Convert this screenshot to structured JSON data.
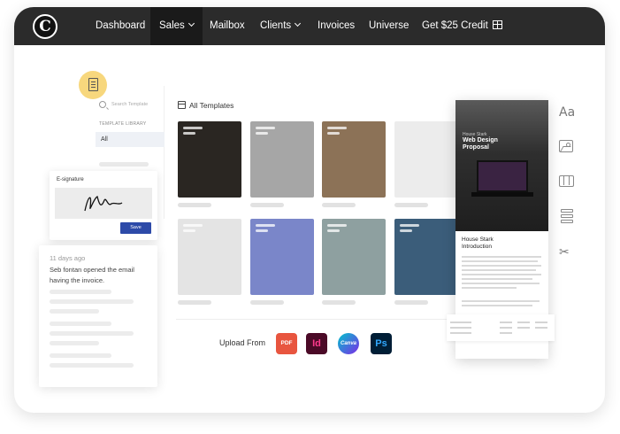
{
  "app": {
    "logo_letter": "C"
  },
  "nav": {
    "dashboard": "Dashboard",
    "sales": "Sales",
    "mailbox": "Mailbox",
    "clients": "Clients",
    "invoices": "Invoices",
    "universe": "Universe",
    "credit": "Get $25 Credit"
  },
  "sidebar": {
    "search_placeholder": "Search Template",
    "library_label": "TEMPLATE LIBRARY",
    "active_item": "All"
  },
  "esignature": {
    "title": "E-signature",
    "save_label": "Save"
  },
  "activity": {
    "time": "11 days ago",
    "message": "Seb fontan opened the email having the invoice."
  },
  "templates": {
    "header": "All Templates",
    "items": [
      {
        "name": "desk-setup",
        "color": "#2a2622"
      },
      {
        "name": "camera",
        "color": "#a6a6a6"
      },
      {
        "name": "team-meeting",
        "color": "#8c7257"
      },
      {
        "name": "blank",
        "color": "#ececec"
      },
      {
        "name": "plant",
        "color": "#e4e4e4"
      },
      {
        "name": "abstract-3d",
        "color": "#7a86c9"
      },
      {
        "name": "workspace-top",
        "color": "#8ea0a0"
      },
      {
        "name": "building",
        "color": "#3b5d7a"
      }
    ]
  },
  "upload": {
    "label": "Upload From",
    "apps": [
      {
        "name": "pdf",
        "text": "PDF"
      },
      {
        "name": "indesign",
        "text": "Id"
      },
      {
        "name": "canva",
        "text": "Canva"
      },
      {
        "name": "photoshop",
        "text": "Ps"
      }
    ]
  },
  "proposal": {
    "subtitle": "House Stark",
    "title": "Web Design Proposal",
    "section": "House Stark Introduction"
  },
  "tools": [
    "text-icon",
    "image-icon",
    "columns-icon",
    "rows-icon",
    "scissors-icon"
  ]
}
